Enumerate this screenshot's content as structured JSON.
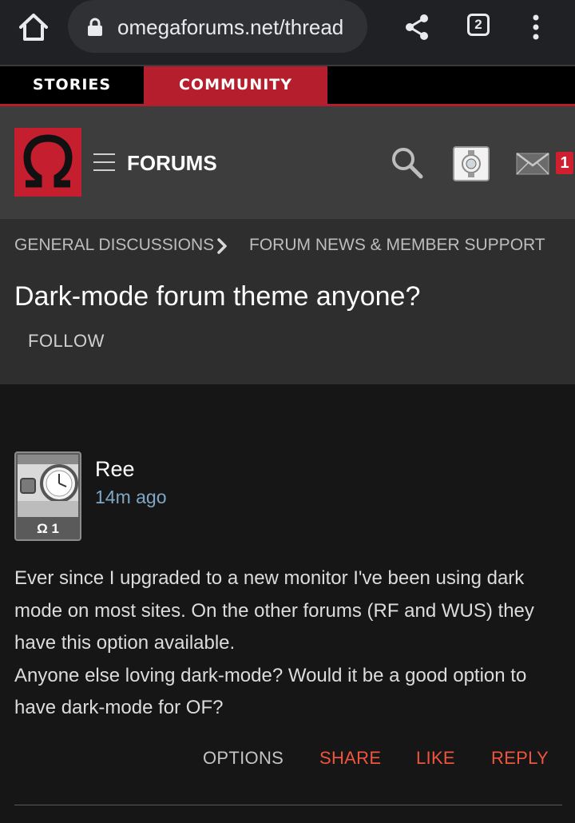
{
  "browser": {
    "url": "omegaforums.net/thread",
    "tab_count": "2"
  },
  "site_tabs": {
    "stories": "STORIES",
    "community": "COMMUNITY"
  },
  "header": {
    "logo_glyph": "Ω",
    "forums_label": "FORUMS",
    "mail_badge": "1",
    "brand_color": "#c41e2f"
  },
  "breadcrumb": {
    "items": [
      "GENERAL DISCUSSIONS",
      "FORUM NEWS & MEMBER SUPPORT"
    ]
  },
  "thread": {
    "title": "Dark-mode forum theme anyone?",
    "follow_label": "FOLLOW"
  },
  "post": {
    "author": "Ree",
    "time": "14m ago",
    "rank": "Ω 1",
    "body_lines": [
      "Ever since I upgraded to a new monitor I've been using dark mode on most sites. On the other forums (RF and WUS) they have this option available.",
      "Anyone else loving dark-mode? Would it be a good option to have dark-mode for OF?"
    ],
    "actions": {
      "options": "OPTIONS",
      "share": "SHARE",
      "like": "LIKE",
      "reply": "REPLY"
    }
  }
}
